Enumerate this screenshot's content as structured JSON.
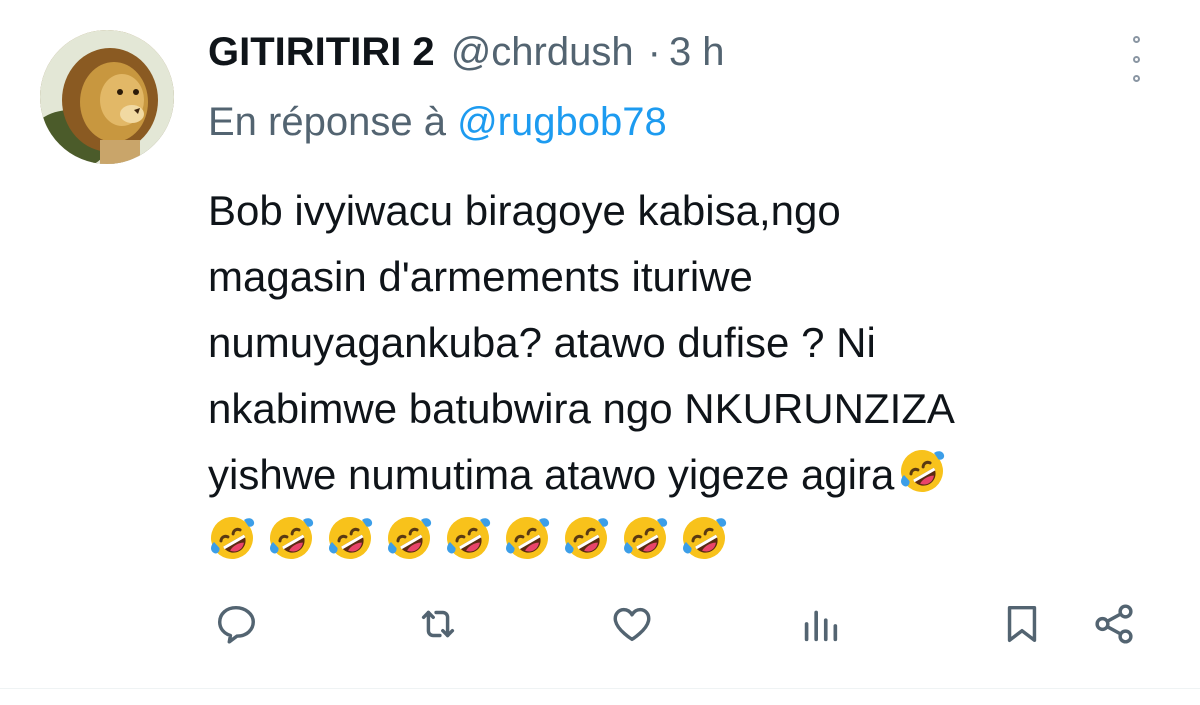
{
  "author": {
    "display_name": "GITIRITIRI 2",
    "handle": "@chrdush",
    "separator": "·",
    "time": "3 h",
    "avatar_icon": "lion-avatar"
  },
  "reply_context": {
    "prefix": "En réponse à",
    "mention": "@rugbob78"
  },
  "body": {
    "lines": [
      "Bob ivyiwacu biragoye kabisa,ngo",
      "magasin d'armements ituriwe",
      "numuyagankuba? atawo dufise ? Ni",
      "nkabimwe batubwira ngo NKURUNZIZA",
      "yishwe numutima atawo yigeze agira"
    ],
    "emoji": "rolling-on-floor-laughing-emoji",
    "trailing_emoji_count": 9
  },
  "actions": [
    {
      "name": "reply",
      "icon": "reply-icon"
    },
    {
      "name": "retweet",
      "icon": "retweet-icon"
    },
    {
      "name": "like",
      "icon": "heart-icon"
    },
    {
      "name": "views",
      "icon": "analytics-icon"
    },
    {
      "name": "bookmark",
      "icon": "bookmark-icon"
    },
    {
      "name": "share",
      "icon": "share-icon"
    }
  ],
  "colors": {
    "text": "#0f1419",
    "secondary": "#536471",
    "link": "#1d9bf0",
    "emoji_face": "#f8c21b",
    "emoji_tears": "#3c9ee8"
  }
}
